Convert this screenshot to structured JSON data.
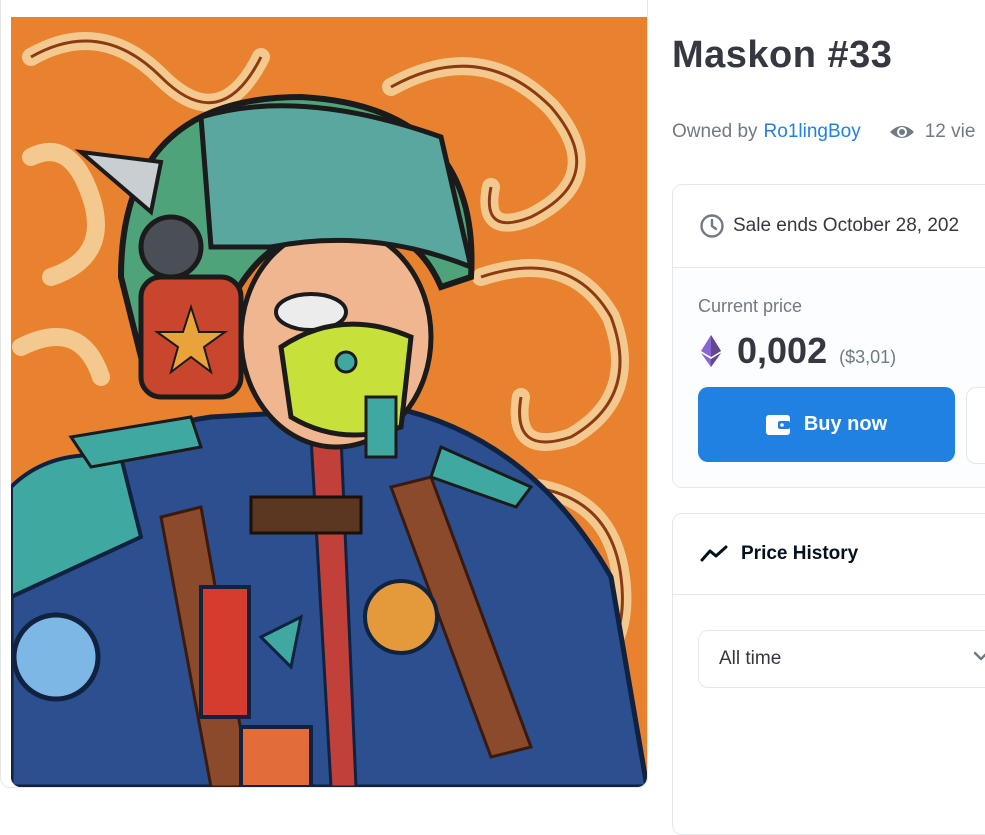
{
  "item": {
    "title": "Maskon #33",
    "owned_by_label": "Owned by",
    "owner": "Ro1lingBoy",
    "views": "12 vie"
  },
  "sale": {
    "ends_text": "Sale ends October 28, 202",
    "current_price_label": "Current price",
    "price": "0,002",
    "price_usd": "($3,01)",
    "buy_label": "Buy now"
  },
  "price_history": {
    "title": "Price History",
    "range_selected": "All time"
  },
  "colors": {
    "accent": "#2081e2",
    "eth_icon": "#8a63d2",
    "art_background": "#e8822f"
  },
  "icons": [
    "clock-icon",
    "eye-icon",
    "ethereum-icon",
    "wallet-icon",
    "chart-trend-icon",
    "chevron-down-icon"
  ]
}
